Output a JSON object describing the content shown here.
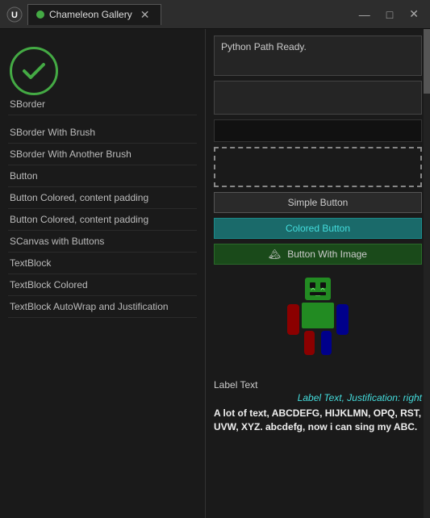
{
  "titlebar": {
    "icon_label": "unreal-icon",
    "dot_color": "#44aa44",
    "tab_title": "Chameleon Gallery",
    "close_label": "✕",
    "minimize_label": "—",
    "maximize_label": "□",
    "window_close_label": "✕"
  },
  "left_panel": {
    "items": [
      {
        "id": "sborder",
        "label": "SBorder"
      },
      {
        "id": "sborder-brush",
        "label": "SBorder With Brush"
      },
      {
        "id": "sborder-another-brush",
        "label": "SBorder With Another Brush"
      },
      {
        "id": "button",
        "label": "Button"
      },
      {
        "id": "button-colored-1",
        "label": "Button Colored, content padding"
      },
      {
        "id": "button-colored-2",
        "label": "Button Colored, content padding"
      },
      {
        "id": "scanvas-buttons",
        "label": "SCanvas with Buttons"
      },
      {
        "id": "textblock",
        "label": "TextBlock"
      },
      {
        "id": "textblock-colored",
        "label": "TextBlock Colored"
      },
      {
        "id": "textblock-autowrap",
        "label": "TextBlock AutoWrap and Justification"
      }
    ]
  },
  "right_panel": {
    "output_text": "Python Path Ready.",
    "simple_button_label": "Simple Button",
    "colored_button_label": "Colored Button",
    "image_button_label": "Button With Image",
    "image_button_icon": "🏔",
    "label_text_plain": "Label Text",
    "label_text_colored": "Label Text, Justification: right",
    "body_text": "A lot of text, ABCDEFG, HIJKLMN, OPQ, RST, UVW, XYZ. abcdefg, now i can sing my ABC."
  },
  "colors": {
    "teal": "#44dddd",
    "green_btn_bg": "#1a4a1a",
    "teal_btn_bg": "#1a6a6a",
    "robot_head": "#228b22",
    "robot_body": "#228b22",
    "robot_arm_left": "#8b0000",
    "robot_arm_right": "#00008b",
    "robot_leg_left": "#8b0000",
    "robot_leg_right": "#00008b"
  }
}
